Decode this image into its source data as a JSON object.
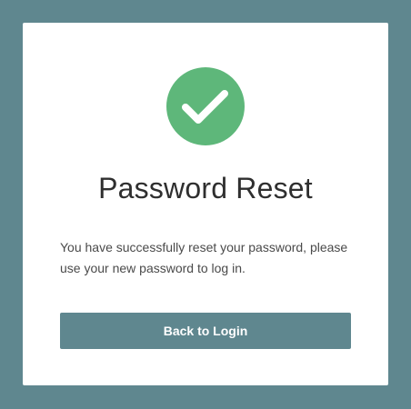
{
  "colors": {
    "page_background": "#5f878f",
    "card_background": "#ffffff",
    "success_green": "#5eb77a",
    "button_background": "#5f878f",
    "button_text": "#ffffff",
    "title_text": "#2f2f2f",
    "body_text": "#4a4a4a"
  },
  "status_icon": "checkmark-circle-icon",
  "title": "Password Reset",
  "message": "You have successfully reset your password, please use your new password to log in.",
  "actions": {
    "back_to_login_label": "Back to Login"
  }
}
